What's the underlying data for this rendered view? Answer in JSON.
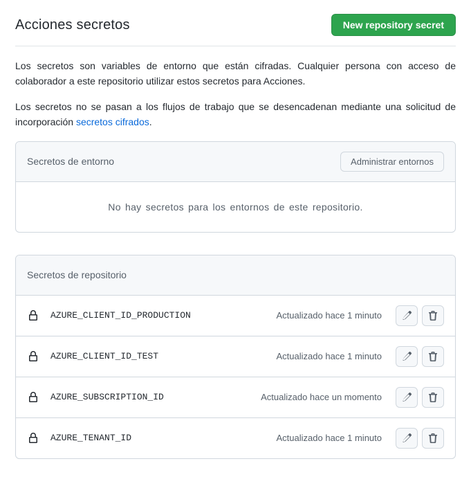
{
  "header": {
    "title": "Acciones secretos",
    "new_secret_label": "New repository secret"
  },
  "description": {
    "line1": "Los secretos son variables de entorno que están cifradas. Cualquier persona con acceso de colaborador a este repositorio utilizar estos secretos para Acciones.",
    "line2_prefix": "Los secretos no se pasan a los flujos de trabajo que se desencadenan mediante una solicitud de incorporación ",
    "line2_link": "secretos cifrados",
    "line2_suffix": "."
  },
  "env_panel": {
    "title": "Secretos de entorno",
    "manage_label": "Administrar entornos",
    "empty_text": "No hay secretos para los entornos de este repositorio."
  },
  "repo_panel": {
    "title": "Secretos de repositorio",
    "secrets": [
      {
        "name": "AZURE_CLIENT_ID_PRODUCTION",
        "updated": "Actualizado hace 1 minuto"
      },
      {
        "name": "AZURE_CLIENT_ID_TEST",
        "updated": "Actualizado hace 1 minuto"
      },
      {
        "name": "AZURE_SUBSCRIPTION_ID",
        "updated": "Actualizado hace un momento"
      },
      {
        "name": "AZURE_TENANT_ID",
        "updated": "Actualizado hace 1 minuto"
      }
    ]
  },
  "icons": {
    "lock": "lock-icon",
    "edit": "pencil-icon",
    "delete": "trash-icon"
  }
}
